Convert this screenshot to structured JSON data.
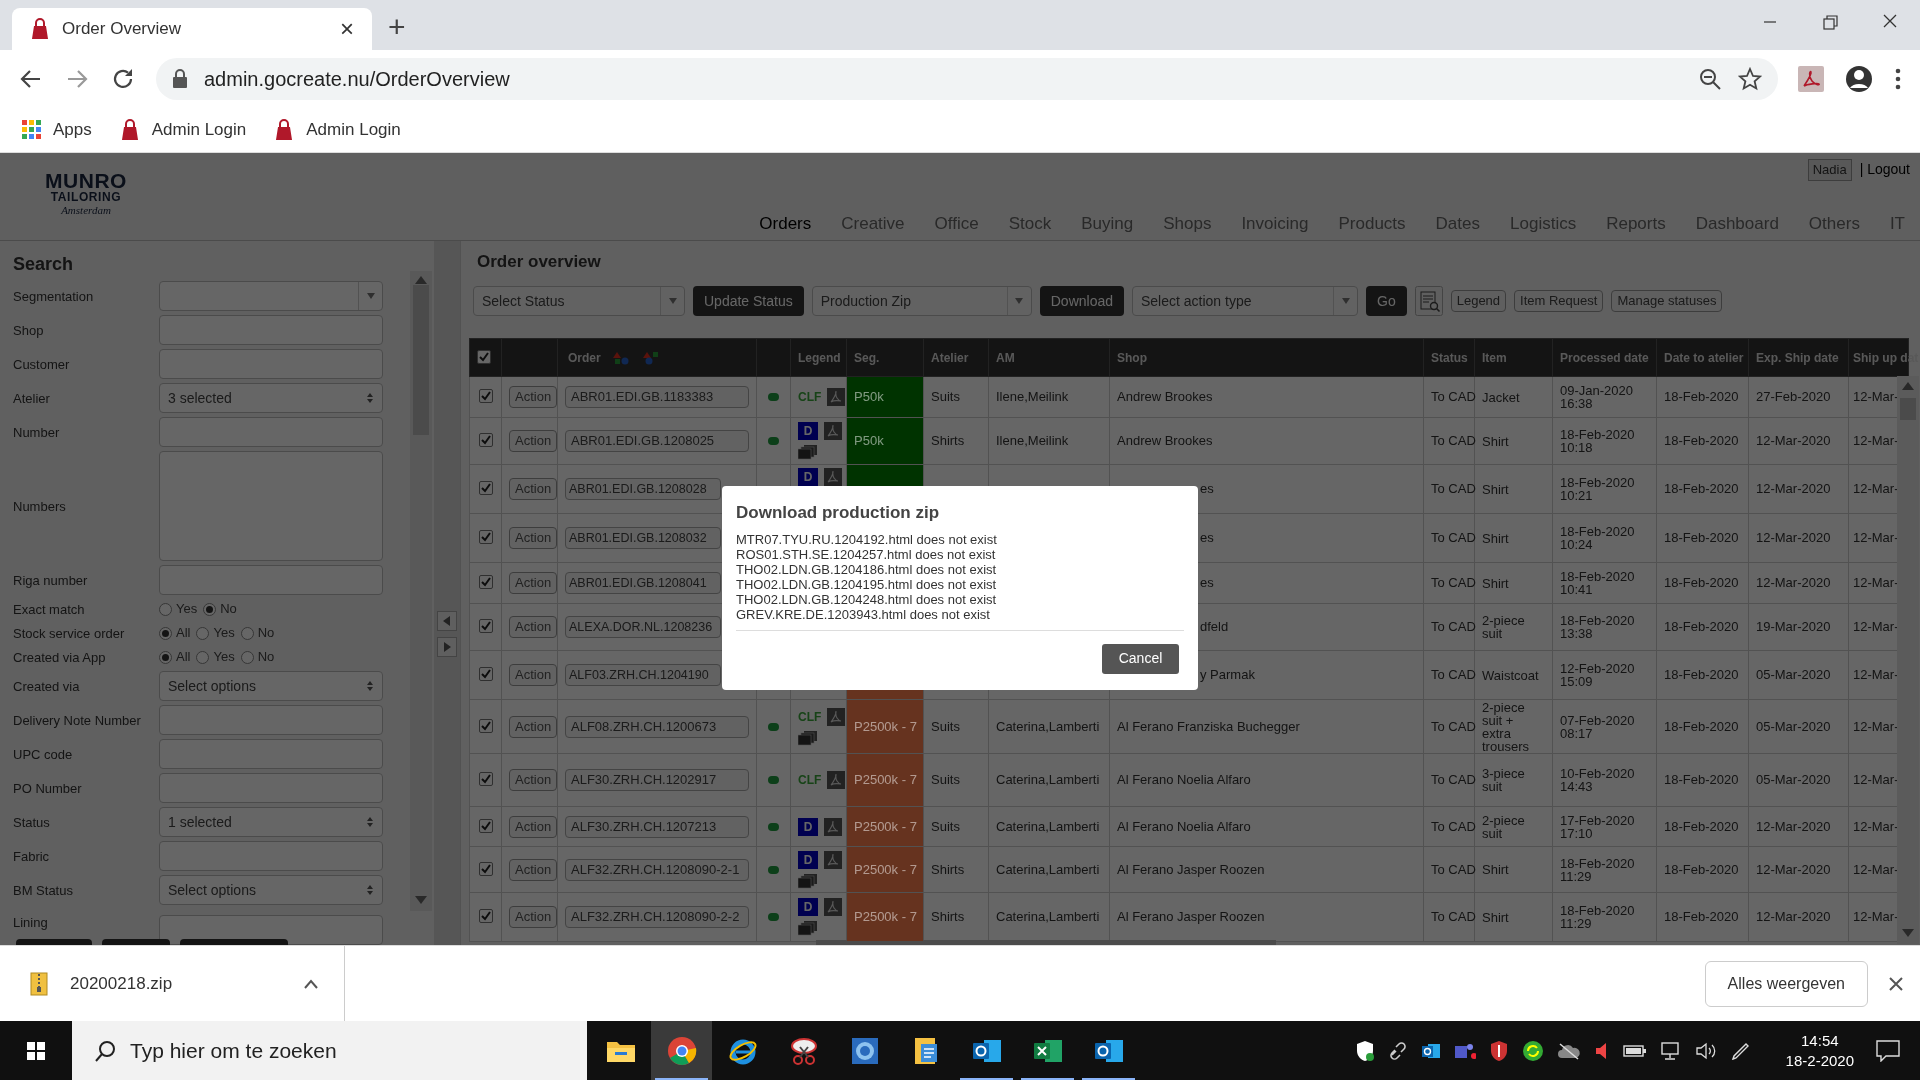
{
  "browser": {
    "tab": {
      "title": "Order Overview",
      "close": "×"
    },
    "new_tab": "+",
    "url": "admin.gocreate.nu/OrderOverview",
    "bookmarks": [
      {
        "kind": "apps",
        "label": "Apps"
      },
      {
        "kind": "site",
        "label": "Admin Login"
      },
      {
        "kind": "site",
        "label": "Admin Login"
      }
    ]
  },
  "user": {
    "name": "Nadia",
    "logout": "| Logout"
  },
  "logo": {
    "name": "MUNRO",
    "line2": "TAILORING",
    "city": "Amsterdam"
  },
  "nav": [
    {
      "label": "Orders",
      "selected": true
    },
    {
      "label": "Creative",
      "selected": false
    },
    {
      "label": "Office",
      "selected": false
    },
    {
      "label": "Stock",
      "selected": false
    },
    {
      "label": "Buying",
      "selected": false
    },
    {
      "label": "Shops",
      "selected": false
    },
    {
      "label": "Invoicing",
      "selected": false
    },
    {
      "label": "Products",
      "selected": false
    },
    {
      "label": "Dates",
      "selected": false
    },
    {
      "label": "Logistics",
      "selected": false
    },
    {
      "label": "Reports",
      "selected": false
    },
    {
      "label": "Dashboard",
      "selected": false
    },
    {
      "label": "Others",
      "selected": false
    },
    {
      "label": "IT",
      "selected": false
    }
  ],
  "search": {
    "title": "Search",
    "fields": [
      {
        "kind": "combo",
        "label": "Segmentation"
      },
      {
        "kind": "input",
        "label": "Shop"
      },
      {
        "kind": "input",
        "label": "Customer"
      },
      {
        "kind": "multi",
        "label": "Atelier",
        "value": "3 selected"
      },
      {
        "kind": "input",
        "label": "Number"
      },
      {
        "kind": "textarea",
        "label": "Numbers"
      },
      {
        "kind": "input",
        "label": "Riga number"
      },
      {
        "kind": "radio",
        "label": "Exact match",
        "options": [
          {
            "label": "Yes",
            "selected": false
          },
          {
            "label": "No",
            "selected": true
          }
        ]
      },
      {
        "kind": "radio",
        "label": "Stock service order",
        "options": [
          {
            "label": "All",
            "selected": true
          },
          {
            "label": "Yes",
            "selected": false
          },
          {
            "label": "No",
            "selected": false
          }
        ]
      },
      {
        "kind": "radio",
        "label": "Created via App",
        "options": [
          {
            "label": "All",
            "selected": true
          },
          {
            "label": "Yes",
            "selected": false
          },
          {
            "label": "No",
            "selected": false
          }
        ]
      },
      {
        "kind": "multi",
        "label": "Created via",
        "value": "Select options"
      },
      {
        "kind": "input",
        "label": "Delivery Note Number"
      },
      {
        "kind": "input",
        "label": "UPC code"
      },
      {
        "kind": "input",
        "label": "PO Number"
      },
      {
        "kind": "multi",
        "label": "Status",
        "value": "1 selected"
      },
      {
        "kind": "input",
        "label": "Fabric"
      },
      {
        "kind": "multi",
        "label": "BM Status",
        "value": "Select options"
      },
      {
        "kind": "input",
        "label": "Lining"
      }
    ]
  },
  "main": {
    "title": "Order overview",
    "toolbar": [
      {
        "kind": "combo",
        "label": "Select Status"
      },
      {
        "kind": "dark",
        "label": "Update Status"
      },
      {
        "kind": "combo",
        "label": "Production Zip"
      },
      {
        "kind": "dark",
        "label": "Download"
      },
      {
        "kind": "combo",
        "label": "Select action type"
      },
      {
        "kind": "dark",
        "label": "Go"
      },
      {
        "kind": "icon"
      },
      {
        "kind": "outline",
        "label": "Legend"
      },
      {
        "kind": "outline",
        "label": "Item Request"
      },
      {
        "kind": "outline",
        "label": "Manage statuses"
      }
    ],
    "table": {
      "select_all": true,
      "columns": [
        "",
        "",
        "Order",
        "",
        "Legend",
        "Seg.",
        "Atelier",
        "AM",
        "Shop",
        "Status",
        "Item",
        "Processed date",
        "Date to atelier",
        "Exp. Ship date",
        "Ship up dat"
      ],
      "rows": [
        {
          "checked": true,
          "covered": false,
          "action": "Action",
          "order": "ABR01.EDI.GB.1183383",
          "dot": {
            "color": "#0c3f19"
          },
          "legend": [
            {
              "kind": "tag",
              "text": "CLF"
            },
            {
              "kind": "pdf"
            }
          ],
          "segment": {
            "text": "P50k",
            "color": "#003300"
          },
          "atelier": "Suits",
          "am": "Ilene,Meilink",
          "shop": "Andrew Brookes",
          "status": "To CAD",
          "item": "Jacket",
          "processed": "09-Jan-2020 16:38",
          "to_atelier": "18-Feb-2020",
          "exp_ship": "27-Feb-2020",
          "ship_up": "12-Mar-"
        },
        {
          "checked": true,
          "covered": false,
          "action": "Action",
          "order": "ABR01.EDI.GB.1208025",
          "dot": {
            "color": "#0c3f19"
          },
          "legend": [
            {
              "kind": "box",
              "text": "D"
            },
            {
              "kind": "pdf"
            },
            {
              "kind": "stack"
            }
          ],
          "segment": {
            "text": "P50k",
            "color": "#003300"
          },
          "atelier": "Shirts",
          "am": "Ilene,Meilink",
          "shop": "Andrew Brookes",
          "status": "To CAD",
          "item": "Shirt",
          "processed": "18-Feb-2020 10:18",
          "to_atelier": "18-Feb-2020",
          "exp_ship": "12-Mar-2020",
          "ship_up": "12-Mar-"
        },
        {
          "checked": true,
          "covered": true,
          "action": "Action",
          "order": "ABR01.EDI.GB.1208028",
          "legend": [
            {
              "kind": "box",
              "text": "D"
            },
            {
              "kind": "pdf"
            }
          ],
          "segment": {
            "color": "#003300"
          },
          "shop": "es",
          "status": "To CAD",
          "item": "Shirt",
          "processed": "18-Feb-2020 10:21",
          "to_atelier": "18-Feb-2020",
          "exp_ship": "12-Mar-2020",
          "ship_up": "12-Mar-"
        },
        {
          "checked": true,
          "covered": true,
          "action": "Action",
          "order": "ABR01.EDI.GB.1208032",
          "legend": [],
          "shop": "es",
          "status": "To CAD",
          "item": "Shirt",
          "processed": "18-Feb-2020 10:24",
          "to_atelier": "18-Feb-2020",
          "exp_ship": "12-Mar-2020",
          "ship_up": "12-Mar-"
        },
        {
          "checked": true,
          "covered": true,
          "action": "Action",
          "order": "ABR01.EDI.GB.1208041",
          "legend": [],
          "shop": "es",
          "status": "To CAD",
          "item": "Shirt",
          "processed": "18-Feb-2020 10:41",
          "to_atelier": "18-Feb-2020",
          "exp_ship": "12-Mar-2020",
          "ship_up": "12-Mar-"
        },
        {
          "checked": true,
          "covered": true,
          "action": "Action",
          "order": "ALEXA.DOR.NL.1208236",
          "legend": [],
          "shop": "dfeld",
          "status": "To CAD",
          "item": "2-piece suit",
          "processed": "18-Feb-2020 13:38",
          "to_atelier": "18-Feb-2020",
          "exp_ship": "19-Mar-2020",
          "ship_up": "12-Mar-"
        },
        {
          "checked": true,
          "covered": true,
          "action": "Action",
          "order": "ALF03.ZRH.CH.1204190",
          "legend": [],
          "segment": {
            "color": "#66331f"
          },
          "shop": "y Parmak",
          "status": "To CAD",
          "item": "Waistcoat",
          "processed": "12-Feb-2020 15:09",
          "to_atelier": "18-Feb-2020",
          "exp_ship": "05-Mar-2020",
          "ship_up": "12-Mar-"
        },
        {
          "checked": true,
          "covered": false,
          "action": "Action",
          "order": "ALF08.ZRH.CH.1200673",
          "dot": {
            "color": "#0c3f19"
          },
          "legend": [
            {
              "kind": "tag",
              "text": "CLF"
            },
            {
              "kind": "pdf"
            },
            {
              "kind": "stack"
            }
          ],
          "segment": {
            "text": "P2500k - 7",
            "color": "#66331f"
          },
          "atelier": "Suits",
          "am": "Caterina,Lamberti",
          "shop": "Al Ferano Franziska Buchegger",
          "status": "To CAD",
          "item": "2-piece suit + extra trousers",
          "processed": "07-Feb-2020 08:17",
          "to_atelier": "18-Feb-2020",
          "exp_ship": "05-Mar-2020",
          "ship_up": "12-Mar-"
        },
        {
          "checked": true,
          "covered": false,
          "action": "Action",
          "order": "ALF30.ZRH.CH.1202917",
          "dot": {
            "color": "#0c3f19"
          },
          "legend": [
            {
              "kind": "tag",
              "text": "CLF"
            },
            {
              "kind": "pdf"
            }
          ],
          "segment": {
            "text": "P2500k - 7",
            "color": "#66331f"
          },
          "atelier": "Suits",
          "am": "Caterina,Lamberti",
          "shop": "Al Ferano Noelia Alfaro",
          "status": "To CAD",
          "item": "3-piece suit",
          "processed": "10-Feb-2020 14:43",
          "to_atelier": "18-Feb-2020",
          "exp_ship": "05-Mar-2020",
          "ship_up": "12-Mar-"
        },
        {
          "checked": true,
          "covered": false,
          "action": "Action",
          "order": "ALF30.ZRH.CH.1207213",
          "dot": {
            "color": "#0c3f19"
          },
          "legend": [
            {
              "kind": "box",
              "text": "D"
            },
            {
              "kind": "pdf"
            }
          ],
          "segment": {
            "text": "P2500k - 7",
            "color": "#66331f"
          },
          "atelier": "Suits",
          "am": "Caterina,Lamberti",
          "shop": "Al Ferano Noelia Alfaro",
          "status": "To CAD",
          "item": "2-piece suit",
          "processed": "17-Feb-2020 17:10",
          "to_atelier": "18-Feb-2020",
          "exp_ship": "12-Mar-2020",
          "ship_up": "12-Mar-"
        },
        {
          "checked": true,
          "covered": false,
          "action": "Action",
          "order": "ALF32.ZRH.CH.1208090-2-1",
          "dot": {
            "color": "#0c3f19"
          },
          "legend": [
            {
              "kind": "box",
              "text": "D"
            },
            {
              "kind": "pdf"
            },
            {
              "kind": "stack"
            }
          ],
          "segment": {
            "text": "P2500k - 7",
            "color": "#66331f"
          },
          "atelier": "Shirts",
          "am": "Caterina,Lamberti",
          "shop": "Al Ferano Jasper Roozen",
          "status": "To CAD",
          "item": "Shirt",
          "processed": "18-Feb-2020 11:29",
          "to_atelier": "18-Feb-2020",
          "exp_ship": "12-Mar-2020",
          "ship_up": "12-Mar-"
        },
        {
          "checked": true,
          "covered": false,
          "action": "Action",
          "order": "ALF32.ZRH.CH.1208090-2-2",
          "dot": {
            "color": "#0c3f19"
          },
          "legend": [
            {
              "kind": "box",
              "text": "D"
            },
            {
              "kind": "pdf"
            },
            {
              "kind": "stack"
            }
          ],
          "segment": {
            "text": "P2500k - 7",
            "color": "#66331f"
          },
          "atelier": "Shirts",
          "am": "Caterina,Lamberti",
          "shop": "Al Ferano Jasper Roozen",
          "status": "To CAD",
          "item": "Shirt",
          "processed": "18-Feb-2020 11:29",
          "to_atelier": "18-Feb-2020",
          "exp_ship": "12-Mar-2020",
          "ship_up": "12-Mar-"
        }
      ]
    }
  },
  "dialog": {
    "title": "Download production zip",
    "lines": [
      "MTR07.TYU.RU.1204192.html does not exist",
      "ROS01.STH.SE.1204257.html does not exist",
      "THO02.LDN.GB.1204186.html does not exist",
      "THO02.LDN.GB.1204195.html does not exist",
      "THO02.LDN.GB.1204248.html does not exist",
      "GREV.KRE.DE.1203943.html does not exist"
    ],
    "button": "Cancel"
  },
  "downloads": {
    "file": "20200218.zip",
    "show_all": "Alles weergeven"
  },
  "taskbar": {
    "search_placeholder": "Typ hier om te zoeken",
    "apps": [
      {
        "kind": "folder",
        "active": false
      },
      {
        "kind": "chrome",
        "active": true
      },
      {
        "kind": "ie",
        "active": false
      },
      {
        "kind": "snip",
        "active": false
      },
      {
        "kind": "doc",
        "active": false
      },
      {
        "kind": "files",
        "active": false
      },
      {
        "kind": "mail",
        "active": true
      },
      {
        "kind": "sheet",
        "active": true
      },
      {
        "kind": "mail",
        "active": true
      }
    ],
    "time": "14:54",
    "date": "18-2-2020"
  }
}
